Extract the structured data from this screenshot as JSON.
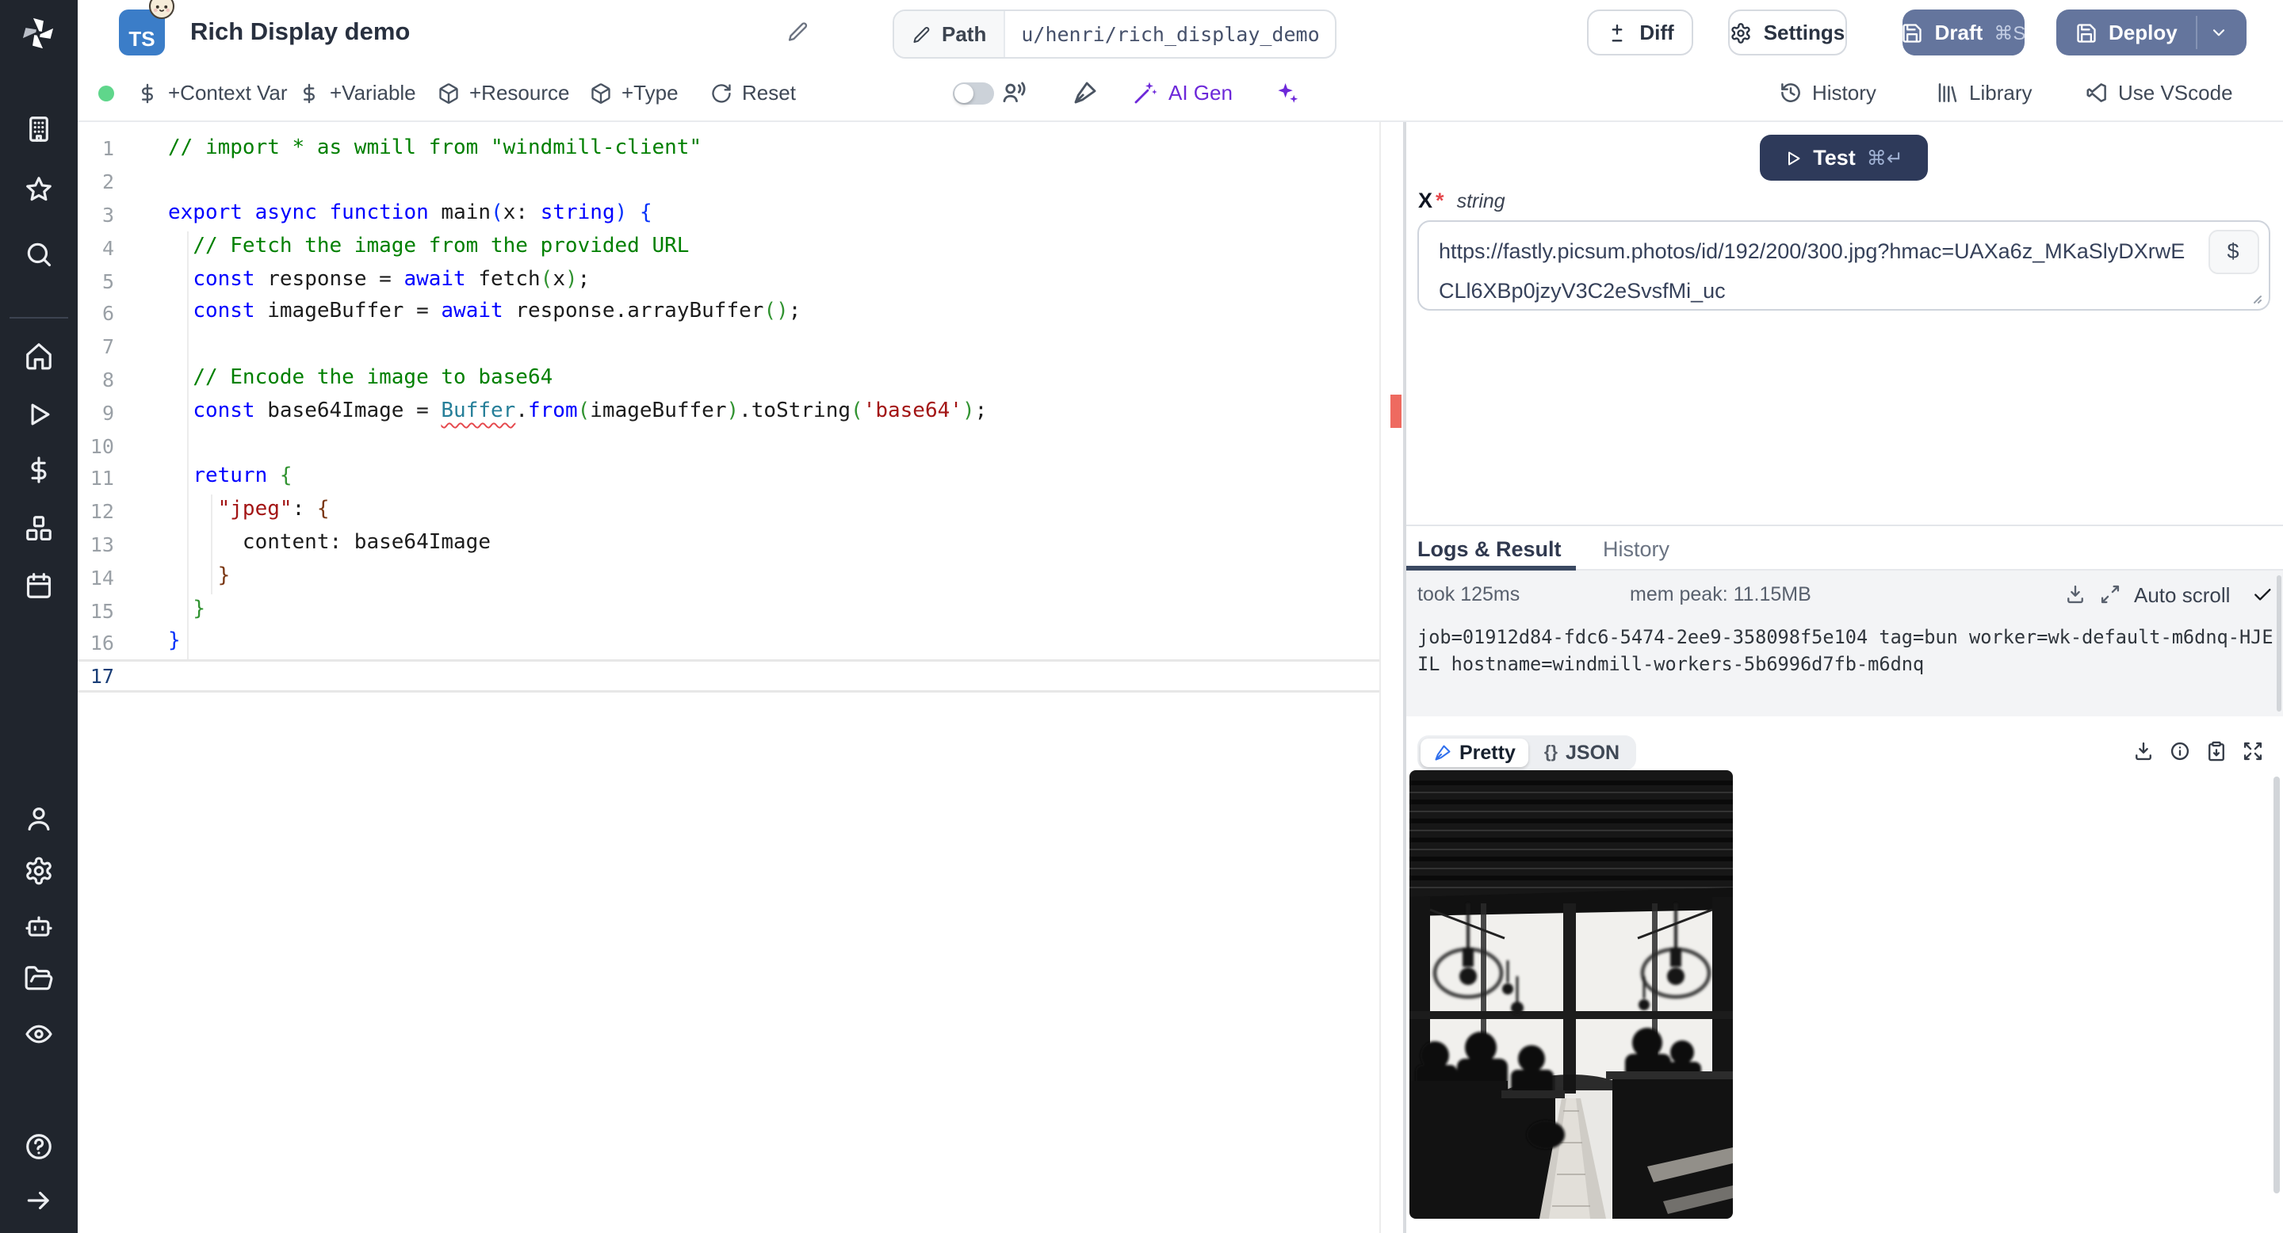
{
  "header": {
    "lang_badge": "TS",
    "title": "Rich Display demo",
    "path_label": "Path",
    "path_value": "u/henri/rich_display_demo",
    "diff": "Diff",
    "settings": "Settings",
    "draft": "Draft",
    "draft_shortcut": "⌘S",
    "deploy": "Deploy"
  },
  "toolbar": {
    "context_var": "+Context Var",
    "variable": "+Variable",
    "resource": "+Resource",
    "type": "+Type",
    "reset": "Reset",
    "ai_gen": "AI Gen",
    "history": "History",
    "library": "Library",
    "use_vscode": "Use VScode"
  },
  "colors": {
    "accent_navy": "#2e3a5a",
    "button_slate": "#64759d",
    "ai_purple": "#6d28d9",
    "status_green": "#5fd68b",
    "error_red": "#ee6a60"
  },
  "code": {
    "lines": [
      {
        "n": 1,
        "tokens": [
          {
            "t": "// import * as wmill from \"windmill-client\"",
            "c": "cm"
          }
        ]
      },
      {
        "n": 2,
        "tokens": []
      },
      {
        "n": 3,
        "tokens": [
          {
            "t": "export",
            "c": "kw"
          },
          {
            "t": " ",
            "c": "pl"
          },
          {
            "t": "async",
            "c": "kw"
          },
          {
            "t": " ",
            "c": "pl"
          },
          {
            "t": "function",
            "c": "kw"
          },
          {
            "t": " main",
            "c": "pl"
          },
          {
            "t": "(",
            "c": "b1"
          },
          {
            "t": "x",
            "c": "pl"
          },
          {
            "t": ": ",
            "c": "pl"
          },
          {
            "t": "string",
            "c": "kw"
          },
          {
            "t": ")",
            "c": "b1"
          },
          {
            "t": " ",
            "c": "pl"
          },
          {
            "t": "{",
            "c": "b1"
          }
        ]
      },
      {
        "n": 4,
        "tokens": [
          {
            "t": "  ",
            "c": "pl"
          },
          {
            "t": "// Fetch the image from the provided URL",
            "c": "cm"
          }
        ]
      },
      {
        "n": 5,
        "tokens": [
          {
            "t": "  ",
            "c": "pl"
          },
          {
            "t": "const",
            "c": "kw"
          },
          {
            "t": " response = ",
            "c": "pl"
          },
          {
            "t": "await",
            "c": "kw"
          },
          {
            "t": " fetch",
            "c": "pl"
          },
          {
            "t": "(",
            "c": "b2"
          },
          {
            "t": "x",
            "c": "pl"
          },
          {
            "t": ")",
            "c": "b2"
          },
          {
            "t": ";",
            "c": "pl"
          }
        ]
      },
      {
        "n": 6,
        "tokens": [
          {
            "t": "  ",
            "c": "pl"
          },
          {
            "t": "const",
            "c": "kw"
          },
          {
            "t": " imageBuffer = ",
            "c": "pl"
          },
          {
            "t": "await",
            "c": "kw"
          },
          {
            "t": " response.arrayBuffer",
            "c": "pl"
          },
          {
            "t": "(",
            "c": "b2"
          },
          {
            "t": ")",
            "c": "b2"
          },
          {
            "t": ";",
            "c": "pl"
          }
        ]
      },
      {
        "n": 7,
        "tokens": []
      },
      {
        "n": 8,
        "tokens": [
          {
            "t": "  ",
            "c": "pl"
          },
          {
            "t": "// Encode the image to base64",
            "c": "cm"
          }
        ]
      },
      {
        "n": 9,
        "tokens": [
          {
            "t": "  ",
            "c": "pl"
          },
          {
            "t": "const",
            "c": "kw"
          },
          {
            "t": " base64Image = ",
            "c": "pl"
          },
          {
            "t": "Buffer",
            "c": "ty",
            "u": true
          },
          {
            "t": ".",
            "c": "pl"
          },
          {
            "t": "from",
            "c": "kw"
          },
          {
            "t": "(",
            "c": "b2"
          },
          {
            "t": "imageBuffer",
            "c": "pl"
          },
          {
            "t": ")",
            "c": "b2"
          },
          {
            "t": ".toString",
            "c": "pl"
          },
          {
            "t": "(",
            "c": "b2"
          },
          {
            "t": "'base64'",
            "c": "st"
          },
          {
            "t": ")",
            "c": "b2"
          },
          {
            "t": ";",
            "c": "pl"
          }
        ]
      },
      {
        "n": 10,
        "tokens": []
      },
      {
        "n": 11,
        "tokens": [
          {
            "t": "  ",
            "c": "pl"
          },
          {
            "t": "return",
            "c": "kw"
          },
          {
            "t": " ",
            "c": "pl"
          },
          {
            "t": "{",
            "c": "b2"
          }
        ]
      },
      {
        "n": 12,
        "tokens": [
          {
            "t": "    ",
            "c": "pl"
          },
          {
            "t": "\"jpeg\"",
            "c": "st"
          },
          {
            "t": ": ",
            "c": "pl"
          },
          {
            "t": "{",
            "c": "b3"
          }
        ]
      },
      {
        "n": 13,
        "tokens": [
          {
            "t": "      content: base64Image",
            "c": "pl"
          }
        ]
      },
      {
        "n": 14,
        "tokens": [
          {
            "t": "    ",
            "c": "pl"
          },
          {
            "t": "}",
            "c": "b3"
          }
        ]
      },
      {
        "n": 15,
        "tokens": [
          {
            "t": "  ",
            "c": "pl"
          },
          {
            "t": "}",
            "c": "b2"
          }
        ]
      },
      {
        "n": 16,
        "tokens": [
          {
            "t": "}",
            "c": "b1"
          }
        ]
      },
      {
        "n": 17,
        "tokens": [],
        "current": true
      }
    ]
  },
  "run_panel": {
    "test_label": "Test",
    "test_shortcut": "⌘↵",
    "arg_name": "x",
    "arg_required_mark": "*",
    "arg_type": "string",
    "arg_value": "https://fastly.picsum.photos/id/192/200/300.jpg?hmac=UAXa6z_MKaSlyDXrwECLl6XBp0jzyV3C2eSvsfMi_uc",
    "dollar_button": "$"
  },
  "result_panel": {
    "tab_logs": "Logs & Result",
    "tab_history": "History",
    "took": "took 125ms",
    "mem_peak": "mem peak: 11.15MB",
    "auto_scroll": "Auto scroll",
    "log_line": "job=01912d84-fdc6-5474-2ee9-358098f5e104 tag=bun worker=wk-default-m6dnq-HJEIL hostname=windmill-workers-5b6996d7fb-m6dnq",
    "view_pretty": "Pretty",
    "view_json": "JSON",
    "braces_glyph": "{}"
  }
}
